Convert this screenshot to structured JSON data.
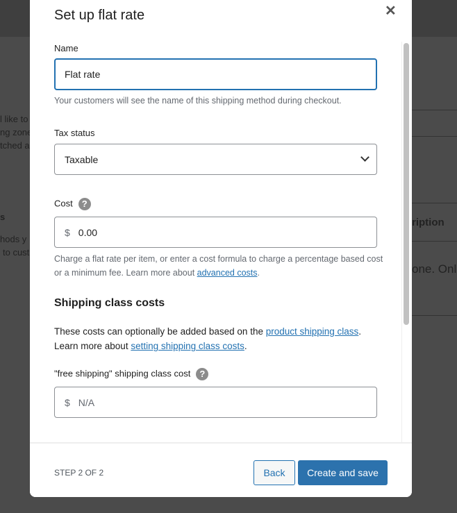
{
  "background": {
    "fragments": [
      "l like to",
      "ng zone",
      "tched a",
      "s",
      "hods y",
      "to cust",
      "ription",
      "one. Onl"
    ]
  },
  "modal": {
    "title": "Set up flat rate",
    "name": {
      "label": "Name",
      "value": "Flat rate",
      "help": "Your customers will see the name of this shipping method during checkout."
    },
    "tax": {
      "label": "Tax status",
      "value": "Taxable"
    },
    "cost": {
      "label": "Cost",
      "currency": "$",
      "value": "0.00",
      "help": "Charge a flat rate per item, or enter a cost formula to charge a percentage based cost or a minimum fee. Learn more about ",
      "help_link": "advanced costs",
      "help_end": "."
    },
    "shipping_class": {
      "heading": "Shipping class costs",
      "text1": "These costs can optionally be added based on the ",
      "link1": "product shipping class",
      "text2": ". Learn more about ",
      "link2": "setting shipping class costs",
      "text3": "."
    },
    "free_shipping": {
      "label": "\"free shipping\" shipping class cost",
      "currency": "$",
      "placeholder": "N/A"
    },
    "footer": {
      "step": "STEP 2 OF 2",
      "back": "Back",
      "save": "Create and save"
    }
  }
}
